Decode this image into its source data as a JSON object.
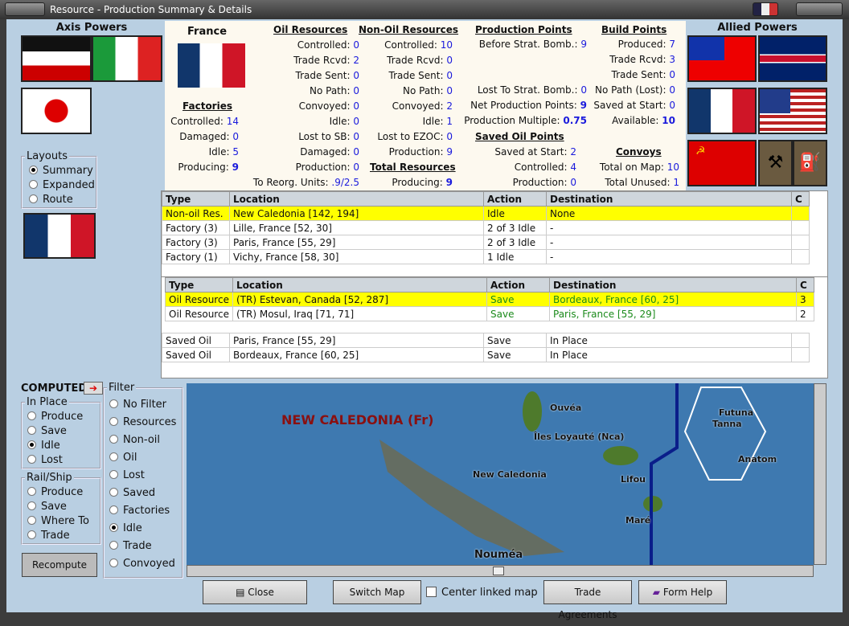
{
  "window": {
    "title": "Resource - Production Summary & Details"
  },
  "left": {
    "axis_title": "Axis Powers",
    "axis_flags": [
      "germany-flag",
      "italy-flag",
      "japan-flag"
    ],
    "layouts": {
      "label": "Layouts",
      "options": [
        "Summary",
        "Expanded",
        "Route"
      ],
      "selected": "Summary"
    }
  },
  "right": {
    "allied_title": "Allied Powers",
    "allied_flags": [
      "china-flag",
      "uk-flag",
      "france-flag",
      "usa-flag",
      "ussr-flag",
      "resource-icon",
      "oil-icon"
    ]
  },
  "info": {
    "country": "France",
    "factories": {
      "title": "Factories",
      "rows": [
        [
          "Controlled:",
          "14"
        ],
        [
          "Damaged:",
          "0"
        ],
        [
          "Idle:",
          "5"
        ],
        [
          "Producing:",
          "9"
        ]
      ]
    },
    "oil": {
      "title": "Oil Resources",
      "rows": [
        [
          "Controlled:",
          "0"
        ],
        [
          "Trade Rcvd:",
          "2"
        ],
        [
          "Trade Sent:",
          "0"
        ],
        [
          "No Path:",
          "0"
        ],
        [
          "Convoyed:",
          "0"
        ],
        [
          "Idle:",
          "0"
        ],
        [
          "Lost to SB:",
          "0"
        ],
        [
          "Damaged:",
          "0"
        ],
        [
          "Production:",
          "0"
        ],
        [
          "To Reorg. Units:",
          ".9/2.5"
        ]
      ]
    },
    "nonoil": {
      "title": "Non-Oil Resources",
      "rows": [
        [
          "Controlled:",
          "10"
        ],
        [
          "Trade Rcvd:",
          "0"
        ],
        [
          "Trade Sent:",
          "0"
        ],
        [
          "No Path:",
          "0"
        ],
        [
          "Convoyed:",
          "2"
        ],
        [
          "Idle:",
          "1"
        ],
        [
          "Lost to EZOC:",
          "0"
        ],
        [
          "Production:",
          "9"
        ]
      ]
    },
    "total": {
      "title": "Total Resources",
      "rows": [
        [
          "Producing:",
          "9"
        ]
      ]
    },
    "pp": {
      "title": "Production Points",
      "rows": [
        [
          "Before Strat. Bomb.:",
          "9"
        ],
        [
          "Lost To Strat. Bomb.:",
          "0"
        ],
        [
          "Net Production Points:",
          "9"
        ],
        [
          "Production Multiple:",
          "0.75"
        ]
      ]
    },
    "saved": {
      "title": "Saved Oil Points",
      "rows": [
        [
          "Saved at Start:",
          "2"
        ],
        [
          "Controlled:",
          "4"
        ],
        [
          "Production:",
          "0"
        ]
      ]
    },
    "bp": {
      "title": "Build Points",
      "rows": [
        [
          "Produced:",
          "7"
        ],
        [
          "Trade Rcvd:",
          "3"
        ],
        [
          "Trade Sent:",
          "0"
        ],
        [
          "No Path (Lost):",
          "0"
        ],
        [
          "Saved at Start:",
          "0"
        ],
        [
          "Available:",
          "10"
        ]
      ]
    },
    "convoys": {
      "title": "Convoys",
      "rows": [
        [
          "Total on Map:",
          "10"
        ],
        [
          "Total Unused:",
          "1"
        ]
      ]
    }
  },
  "table1": {
    "headers": [
      "Type",
      "Location",
      "Action",
      "Destination",
      "C"
    ],
    "rows": [
      [
        "Non-oil Res.",
        "New Caledonia [142, 194]",
        "Idle",
        "None",
        ""
      ],
      [
        "Factory (3)",
        "Lille, France [52, 30]",
        "2 of 3 Idle",
        "-",
        ""
      ],
      [
        "Factory (3)",
        "Paris, France [55, 29]",
        "2 of 3 Idle",
        "-",
        ""
      ],
      [
        "Factory (1)",
        "Vichy, France [58, 30]",
        "1 Idle",
        "-",
        ""
      ]
    ]
  },
  "table2": {
    "headers": [
      "Type",
      "Location",
      "Action",
      "Destination",
      "C"
    ],
    "rows": [
      [
        "Oil Resource",
        "(TR) Estevan, Canada [52, 287]",
        "Save",
        "Bordeaux, France [60, 25]",
        "3"
      ],
      [
        "Oil Resource",
        "(TR) Mosul, Iraq [71, 71]",
        "Save",
        "Paris, France [55, 29]",
        "2"
      ]
    ],
    "saved_rows": [
      [
        "Saved Oil",
        "Paris, France [55, 29]",
        "Save",
        "In Place",
        ""
      ],
      [
        "Saved Oil",
        "Bordeaux, France [60, 25]",
        "Save",
        "In Place",
        ""
      ]
    ]
  },
  "computed": {
    "label": "COMPUTED",
    "in_place": {
      "label": "In Place",
      "options": [
        "Produce",
        "Save",
        "Idle",
        "Lost"
      ],
      "selected": "Idle"
    },
    "rail_ship": {
      "label": "Rail/Ship",
      "options": [
        "Produce",
        "Save",
        "Where To",
        "Trade"
      ]
    },
    "recompute": "Recompute"
  },
  "filter": {
    "label": "Filter",
    "options": [
      "No Filter",
      "Resources",
      "Non-oil",
      "Oil",
      "Lost",
      "Saved",
      "Factories",
      "Idle",
      "Trade",
      "Convoyed"
    ],
    "selected": "Idle"
  },
  "map": {
    "title": "NEW CALEDONIA (Fr)",
    "labels": [
      "Ouvéa",
      "Îles Loyauté (Nca)",
      "New Caledonia",
      "Lifou",
      "Maré",
      "Nouméa",
      "Futuna",
      "Tanna",
      "Anatom"
    ]
  },
  "buttons": {
    "close": "Close",
    "switch_map": "Switch Map",
    "center_linked": "Center linked map",
    "trade": "Trade Agreements",
    "help": "Form Help"
  }
}
